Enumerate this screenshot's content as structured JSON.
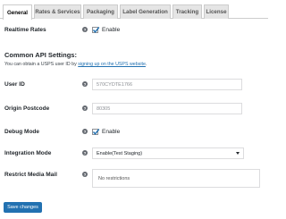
{
  "tabs": [
    {
      "label": "General",
      "active": true
    },
    {
      "label": "Rates & Services",
      "active": false
    },
    {
      "label": "Packaging",
      "active": false
    },
    {
      "label": "Label Generation",
      "active": false
    },
    {
      "label": "Tracking",
      "active": false
    },
    {
      "label": "License",
      "active": false
    }
  ],
  "realtime_rates": {
    "label": "Realtime Rates",
    "checkbox_label": "Enable",
    "checked": true
  },
  "common_api": {
    "title": "Common API Settings:",
    "info_prefix": "You can obtain a USPS user ID by ",
    "info_link": "signing up on the USPS website",
    "info_suffix": "."
  },
  "user_id": {
    "label": "User ID",
    "value": "570CYDTE1766"
  },
  "origin_postcode": {
    "label": "Origin Postcode",
    "value": "80305"
  },
  "debug_mode": {
    "label": "Debug Mode",
    "checkbox_label": "Enable",
    "checked": true
  },
  "integration_mode": {
    "label": "Integration Mode",
    "selected": "Enable(Test Staging)"
  },
  "restrict_media_mail": {
    "label": "Restrict Media Mail",
    "placeholder": "No restrictions"
  },
  "save_button": {
    "label": "Save changes"
  },
  "icons": {
    "help": "help-icon",
    "check": "checkmark-icon",
    "dropdown": "chevron-down-icon"
  },
  "colors": {
    "accent": "#2271b1",
    "help_icon": "#646970"
  }
}
